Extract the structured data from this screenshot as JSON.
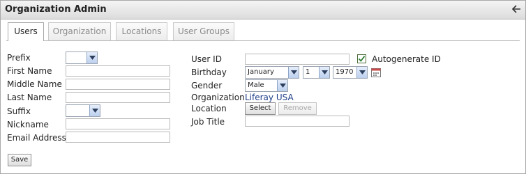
{
  "window": {
    "title": "Organization Admin",
    "back_icon": "back-arrow-icon"
  },
  "tabs": [
    {
      "label": "Users",
      "active": true
    },
    {
      "label": "Organization",
      "active": false
    },
    {
      "label": "Locations",
      "active": false
    },
    {
      "label": "User Groups",
      "active": false
    }
  ],
  "form_left": {
    "prefix": {
      "label": "Prefix",
      "value": ""
    },
    "first_name": {
      "label": "First Name",
      "value": ""
    },
    "middle_name": {
      "label": "Middle Name",
      "value": ""
    },
    "last_name": {
      "label": "Last Name",
      "value": ""
    },
    "suffix": {
      "label": "Suffix",
      "value": ""
    },
    "nickname": {
      "label": "Nickname",
      "value": ""
    },
    "email": {
      "label": "Email Address",
      "value": ""
    }
  },
  "form_right": {
    "user_id": {
      "label": "User ID",
      "value": ""
    },
    "autogenerate": {
      "label": "Autogenerate ID",
      "checked": true
    },
    "birthday": {
      "label": "Birthday",
      "month": "January",
      "day": "1",
      "year": "1970"
    },
    "gender": {
      "label": "Gender",
      "value": "Male"
    },
    "organization": {
      "label": "Organization",
      "value": "Liferay USA"
    },
    "location": {
      "label": "Location",
      "select_label": "Select",
      "remove_label": "Remove"
    },
    "job_title": {
      "label": "Job Title",
      "value": ""
    }
  },
  "actions": {
    "save_label": "Save"
  },
  "colors": {
    "link": "#1f3f8a",
    "check": "#2e7d32"
  }
}
